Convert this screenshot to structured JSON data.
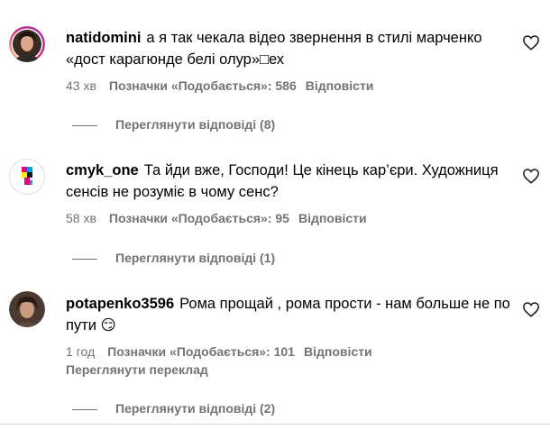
{
  "comments": [
    {
      "username": "natidomini",
      "text": "а я так чекала відео звернення в стилі марченко «дост карагюнде белі олур»□ех",
      "time": "43 хв",
      "likes": "Позначки «Подобається»: 586",
      "reply": "Відповісти",
      "view_replies": "Переглянути відповіді (8)",
      "avatar_icon": "profile-photo"
    },
    {
      "username": "cmyk_one",
      "text": "Та йди вже, Господи! Це кінець кар’єри. Художниця сенсів не розуміє в чому сенс?",
      "time": "58 хв",
      "likes": "Позначки «Подобається»: 95",
      "reply": "Відповісти",
      "view_replies": "Переглянути відповіді (1)",
      "avatar_icon": "colorful-logo"
    },
    {
      "username": "potapenko3596",
      "text": "Рома прощай , рома прости - нам больше не по пути 😏",
      "time": "1 год",
      "likes": "Позначки «Подобається»: 101",
      "reply": "Відповісти",
      "translate": "Переглянути переклад",
      "view_replies": "Переглянути відповіді (2)",
      "avatar_icon": "profile-photo"
    }
  ],
  "icons": {
    "like": "heart-outline-icon"
  },
  "colors": {
    "secondary_text": "#737373",
    "divider": "#dbdbdb"
  }
}
